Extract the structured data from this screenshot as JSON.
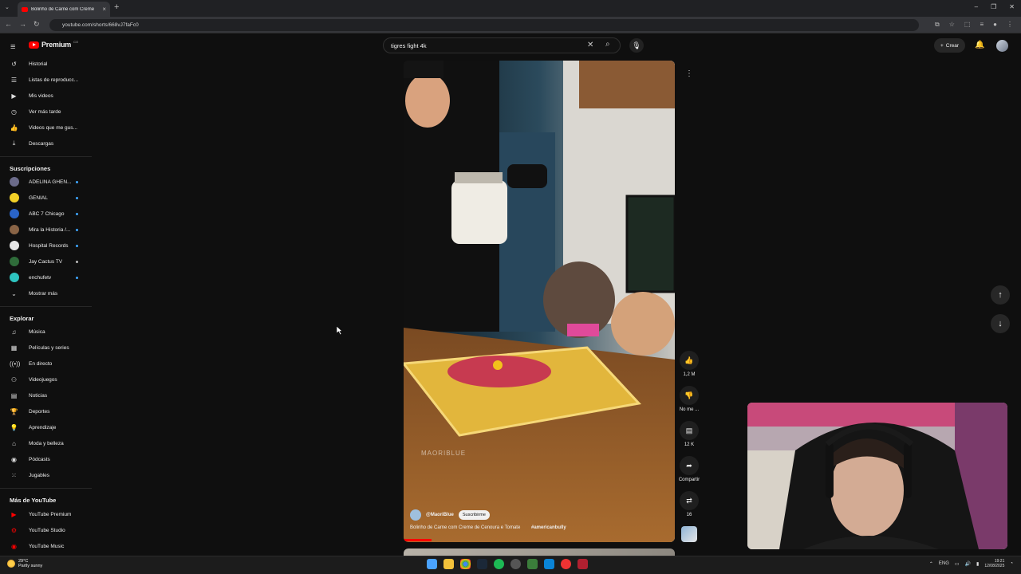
{
  "browser": {
    "tab_title": "Bolinho de Carne com Creme",
    "url": "youtube.com/shorts/668vJ7faFc0"
  },
  "header": {
    "logo_text": "Premium",
    "logo_badge": "CO",
    "search_value": "tigres fight  4k",
    "create_label": "Crear"
  },
  "sidebar": {
    "you_items": [
      {
        "label": "Historial",
        "icon": "history-icon"
      },
      {
        "label": "Listas de reproducc...",
        "icon": "playlist-icon"
      },
      {
        "label": "Mis videos",
        "icon": "my-videos-icon"
      },
      {
        "label": "Ver más tarde",
        "icon": "watch-later-icon"
      },
      {
        "label": "Videos que me gus...",
        "icon": "like-icon"
      },
      {
        "label": "Descargas",
        "icon": "download-icon"
      }
    ],
    "subs_title": "Suscripciones",
    "subscriptions": [
      {
        "label": "ADELINA GHEN...",
        "color": "#6b6b8a"
      },
      {
        "label": "GENIAL",
        "color": "#f2d027"
      },
      {
        "label": "ABC 7 Chicago",
        "color": "#2a64c8"
      },
      {
        "label": "Mira la Historia /...",
        "color": "#8a6446"
      },
      {
        "label": "Hospital Records",
        "color": "#e8e8e8"
      },
      {
        "label": "Jay Cactus TV",
        "color": "#2f6c3a"
      },
      {
        "label": "enchufetv",
        "color": "#2ec4c0"
      }
    ],
    "show_more_label": "Mostrar más",
    "explore_title": "Explorar",
    "explore_items": [
      {
        "label": "Música",
        "icon": "music-icon"
      },
      {
        "label": "Películas y series",
        "icon": "movies-icon"
      },
      {
        "label": "En directo",
        "icon": "live-icon"
      },
      {
        "label": "Videojuegos",
        "icon": "gaming-icon"
      },
      {
        "label": "Noticias",
        "icon": "news-icon"
      },
      {
        "label": "Deportes",
        "icon": "sports-icon"
      },
      {
        "label": "Aprendizaje",
        "icon": "learning-icon"
      },
      {
        "label": "Moda y belleza",
        "icon": "fashion-icon"
      },
      {
        "label": "Pódcasts",
        "icon": "podcast-icon"
      },
      {
        "label": "Jugables",
        "icon": "playables-icon"
      }
    ],
    "more_title": "Más de YouTube",
    "more_items": [
      {
        "label": "YouTube Premium"
      },
      {
        "label": "YouTube Studio"
      },
      {
        "label": "YouTube Music"
      }
    ]
  },
  "short": {
    "channel": "@MaoriBlue",
    "subscribe_label": "Suscribirme",
    "title": "Bolinho de Carne com Creme de Cenoura e Tomate",
    "hashtag": "#americanbully",
    "watermark": "MAORIBLUE",
    "likes": "1,2 M",
    "dislike_label": "No me ...",
    "comments": "12 K",
    "share_label": "Compartir",
    "remix_count": "16"
  },
  "taskbar": {
    "temp": "29°C",
    "weather": "Partly sunny",
    "lang": "ENG",
    "time": "19:21",
    "date": "12/08/2025"
  },
  "colors": {
    "accent": "#ff0000",
    "bg": "#0f0f0f"
  }
}
